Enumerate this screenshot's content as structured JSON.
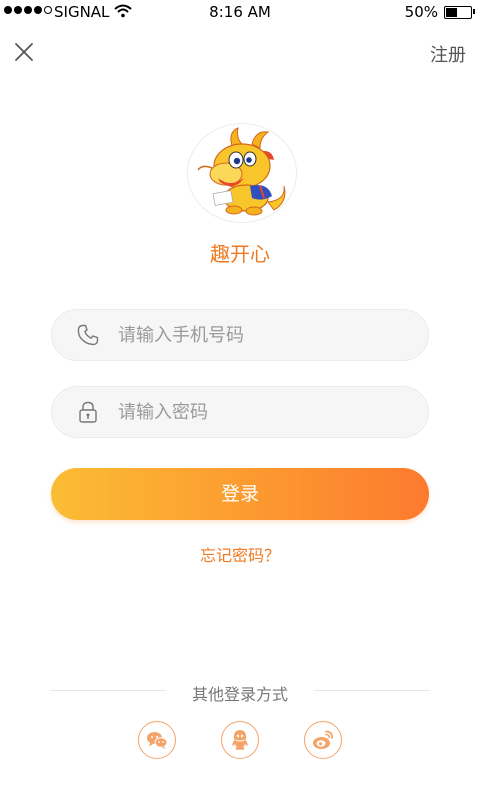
{
  "status_bar": {
    "carrier": "SIGNAL",
    "time": "8:16 AM",
    "battery_percent": "50%",
    "battery_level": 0.5,
    "signal_bars": 4
  },
  "header": {
    "close_icon": "close-icon",
    "register_label": "注册"
  },
  "brand": {
    "name": "趣开心",
    "logo": "dragon-mascot-logo"
  },
  "form": {
    "phone_placeholder": "请输入手机号码",
    "phone_value": "",
    "password_placeholder": "请输入密码",
    "password_value": "",
    "login_label": "登录",
    "forgot_label": "忘记密码？"
  },
  "other_login": {
    "title": "其他登录方式",
    "providers": [
      "wechat-icon",
      "qq-icon",
      "weibo-icon"
    ]
  },
  "colors": {
    "accent": "#f07a21",
    "button_gradient_start": "#fbbd35",
    "button_gradient_end": "#fd7a2f",
    "input_bg": "#f6f6f6"
  }
}
